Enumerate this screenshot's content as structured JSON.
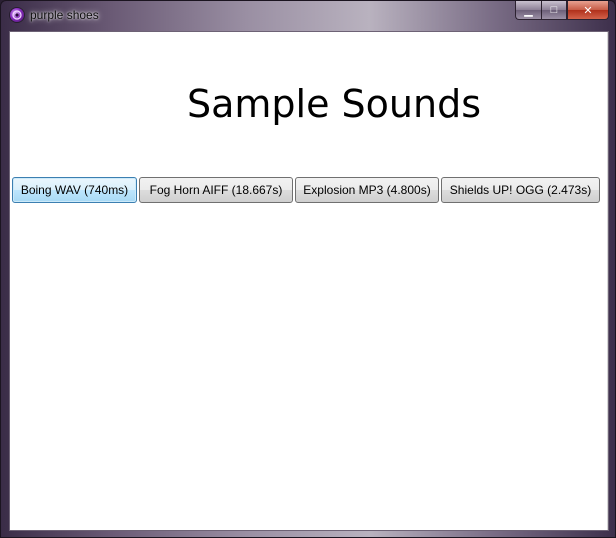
{
  "window": {
    "title": "purple shoes",
    "app_icon": "purple-shoes-logo-icon",
    "caption": {
      "minimize_icon": "minimize-icon",
      "maximize_icon": "maximize-icon",
      "close_icon": "close-icon",
      "minimize_glyph": "▁",
      "maximize_glyph": "□",
      "close_glyph": "✕"
    }
  },
  "main": {
    "title": "Sample Sounds",
    "buttons": [
      {
        "label": "Boing WAV (740ms)",
        "focused": true
      },
      {
        "label": "Fog Horn AIFF (18.667s)",
        "focused": false
      },
      {
        "label": "Explosion MP3 (4.800s)",
        "focused": false
      },
      {
        "label": "Shields UP! OGG (2.473s)",
        "focused": false
      }
    ]
  },
  "colors": {
    "focus_border": "#3c7fb1",
    "close_button": "#c75b45",
    "frame": "#6a5a75"
  }
}
